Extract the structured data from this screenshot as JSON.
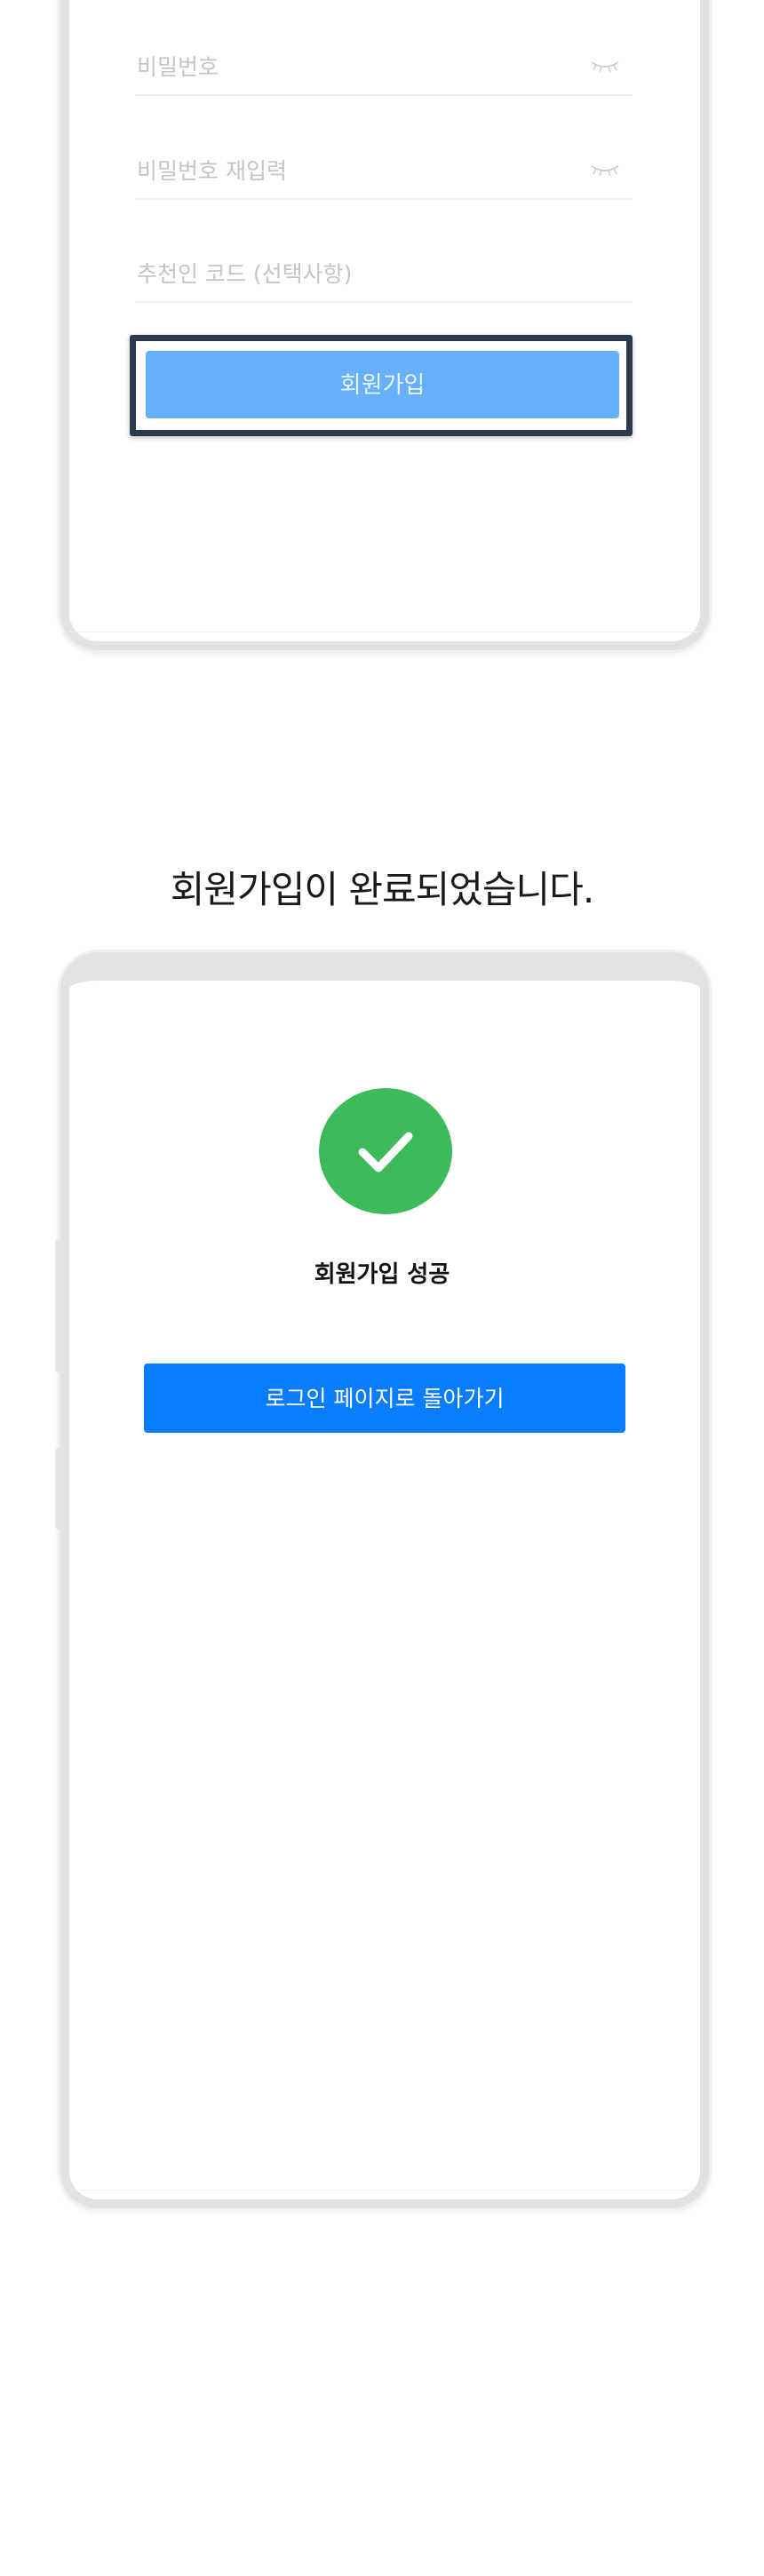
{
  "signup_form": {
    "password_placeholder": "비밀번호",
    "password_confirm_placeholder": "비밀번호 재입력",
    "referral_placeholder": "추천인 코드 (선택사항)",
    "signup_button": "회원가입",
    "eye_icon": "eye-closed-icon"
  },
  "completion": {
    "heading": "회원가입이 완료되었습니다.",
    "status_icon": "check-circle-icon",
    "success_text": "회원가입 성공",
    "login_button": "로그인 페이지로 돌아가기"
  },
  "colors": {
    "signup_button": "#66b0ff",
    "focus_frame": "#2c3a4d",
    "success_green": "#3cba5c",
    "primary_blue": "#0a7cff"
  }
}
